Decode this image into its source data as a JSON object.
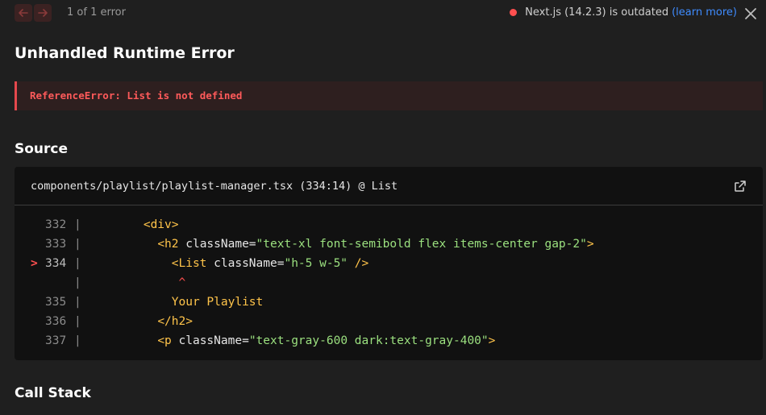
{
  "topbar": {
    "error_count": "1 of 1 error",
    "version_text": "Next.js (14.2.3) is outdated",
    "learn_more": "(learn more)",
    "status_color": "#ff4f4f"
  },
  "title": "Unhandled Runtime Error",
  "error": {
    "message": "ReferenceError: List is not defined"
  },
  "source": {
    "heading": "Source",
    "file": "components/playlist/playlist-manager.tsx (334:14) @ List",
    "lines": [
      {
        "num": "332",
        "marker": "",
        "parts": [
          {
            "cls": "tag",
            "text": "<div>"
          }
        ],
        "indent": "        "
      },
      {
        "num": "333",
        "marker": "",
        "indent": "          ",
        "parts": [
          {
            "cls": "tag",
            "text": "<h2 "
          },
          {
            "cls": "attr",
            "text": "className="
          },
          {
            "cls": "str",
            "text": "\"text-xl font-semibold flex items-center gap-2\""
          },
          {
            "cls": "tag",
            "text": ">"
          }
        ]
      },
      {
        "num": "334",
        "marker": ">",
        "indent": "            ",
        "parts": [
          {
            "cls": "tag",
            "text": "<List "
          },
          {
            "cls": "attr",
            "text": "className="
          },
          {
            "cls": "str",
            "text": "\"h-5 w-5\""
          },
          {
            "cls": "tag",
            "text": " />"
          }
        ]
      },
      {
        "num": "",
        "marker": "",
        "indent": "             ",
        "parts": [
          {
            "cls": "caret",
            "text": "^"
          }
        ]
      },
      {
        "num": "335",
        "marker": "",
        "indent": "            ",
        "parts": [
          {
            "cls": "txt",
            "text": "Your Playlist"
          }
        ]
      },
      {
        "num": "336",
        "marker": "",
        "indent": "          ",
        "parts": [
          {
            "cls": "tag",
            "text": "</h2>"
          }
        ]
      },
      {
        "num": "337",
        "marker": "",
        "indent": "          ",
        "parts": [
          {
            "cls": "tag",
            "text": "<p "
          },
          {
            "cls": "attr",
            "text": "className="
          },
          {
            "cls": "str",
            "text": "\"text-gray-600 dark:text-gray-400\""
          },
          {
            "cls": "tag",
            "text": ">"
          }
        ]
      }
    ]
  },
  "call_stack": {
    "heading": "Call Stack"
  }
}
